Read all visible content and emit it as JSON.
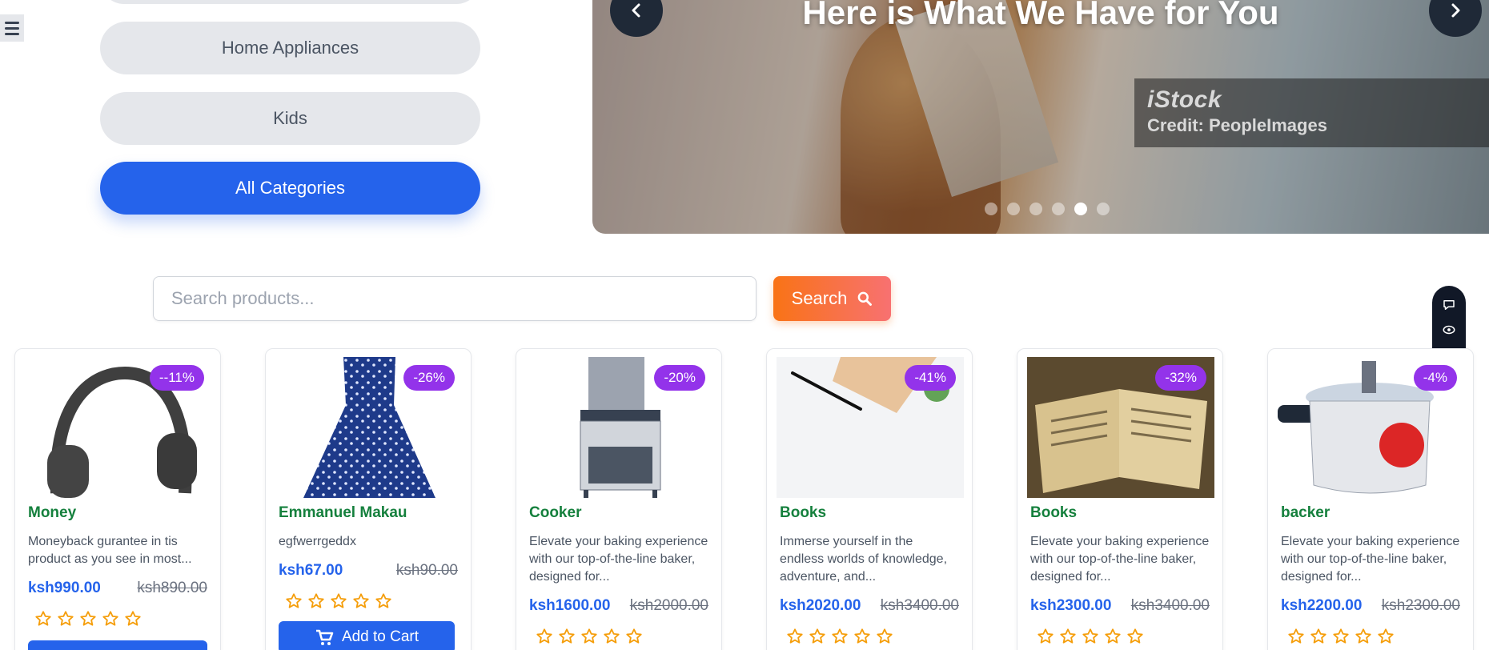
{
  "categories": [
    {
      "label": "Home Appliances"
    },
    {
      "label": "Kids"
    },
    {
      "label": "All Categories",
      "active": true
    }
  ],
  "hero": {
    "title": "Here is What We Have for You",
    "watermark_brand": "iStock",
    "watermark_credit": "Credit: PeopleImages",
    "slide_count": 6,
    "active_slide": 5
  },
  "search": {
    "placeholder": "Search products...",
    "button_label": "Search"
  },
  "colors": {
    "primary": "#2563eb",
    "product_name": "#15803d",
    "badge": "#9333ea",
    "search_button": "#f97316",
    "star": "#f59e0b"
  },
  "products": [
    {
      "name": "Money",
      "discount": "--11%",
      "desc": "Moneyback gurantee in tis product as you see in most...",
      "price": "ksh990.00",
      "old_price": "ksh890.00",
      "rating": 0,
      "image_icon": "headphones-image"
    },
    {
      "name": "Emmanuel Makau",
      "discount": "-26%",
      "desc": "egfwerrgeddx",
      "price": "ksh67.00",
      "old_price": "ksh90.00",
      "rating": 0,
      "cart_label": "Add to Cart",
      "image_icon": "dress-image"
    },
    {
      "name": "Cooker",
      "discount": "-20%",
      "desc": "Elevate your baking experience with our top-of-the-line baker, designed for...",
      "price": "ksh1600.00",
      "old_price": "ksh2000.00",
      "rating": 0,
      "image_icon": "cooker-image"
    },
    {
      "name": "Books",
      "discount": "-41%",
      "desc": "Immerse yourself in the endless worlds of knowledge, adventure, and...",
      "price": "ksh2020.00",
      "old_price": "ksh3400.00",
      "rating": 0,
      "image_icon": "notebook-image"
    },
    {
      "name": "Books",
      "discount": "-32%",
      "desc": "Elevate your baking experience with our top-of-the-line baker, designed for...",
      "price": "ksh2300.00",
      "old_price": "ksh3400.00",
      "rating": 0,
      "image_icon": "open-book-image"
    },
    {
      "name": "backer",
      "discount": "-4%",
      "desc": "Elevate your baking experience with our top-of-the-line baker, designed for...",
      "price": "ksh2200.00",
      "old_price": "ksh2300.00",
      "rating": 0,
      "image_icon": "pressure-cooker-image"
    }
  ]
}
